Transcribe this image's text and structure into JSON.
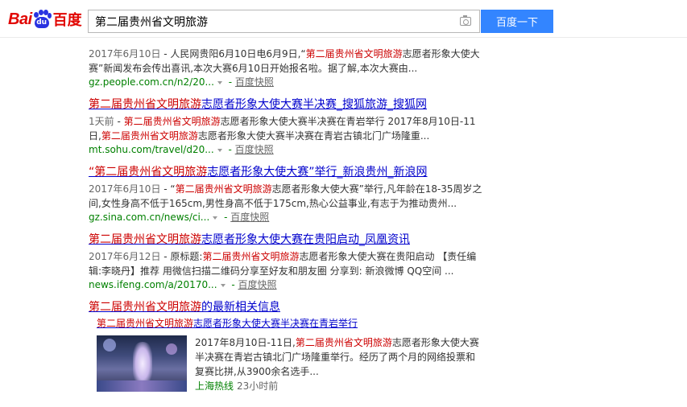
{
  "header": {
    "logo_left": "Bai",
    "logo_paw": "du",
    "logo_right": "百度",
    "search_value": "第二届贵州省文明旅游",
    "search_button": "百度一下"
  },
  "results": [
    {
      "abstract": {
        "date": "2017年6月10日",
        "sep": " - ",
        "pre": "人民网贵阳6月10日电6月9日,“",
        "hl": "第二届贵州省文明旅游",
        "post": "志愿者形象大使大赛”新闻发布会传出喜讯,本次大赛6月10日开始报名啦。据了解,本次大赛由..."
      },
      "url": "gz.people.com.cn/n2/20...",
      "kuaizhao": "百度快照"
    },
    {
      "title": {
        "hl": "第二届贵州省文明旅游",
        "rest": "志愿者形象大使大赛半决赛_搜狐旅游_搜狐网"
      },
      "abstract": {
        "date": "1天前",
        "sep": " - ",
        "hl1": "第二届贵州省文明旅游",
        "mid": "志愿者形象大使大赛半决赛在青岩举行 2017年8月10日-11日,",
        "hl2": "第二届贵州省文明旅游",
        "post": "志愿者形象大使大赛半决赛在青岩古镇北门广场隆重..."
      },
      "url": "mt.sohu.com/travel/d20...",
      "kuaizhao": "百度快照"
    },
    {
      "title": {
        "hl": "“第二届贵州省文明旅游",
        "rest": "志愿者形象大使大赛”举行_新浪贵州_新浪网"
      },
      "abstract": {
        "date": "2017年6月10日",
        "sep": " - ",
        "pre": "“",
        "hl": "第二届贵州省文明旅游",
        "post": "志愿者形象大使大赛”举行,凡年龄在18-35周岁之间,女性身高不低于165cm,男性身高不低于175cm,热心公益事业,有志于为推动贵州..."
      },
      "url": "gz.sina.com.cn/news/ci...",
      "kuaizhao": "百度快照"
    },
    {
      "title": {
        "hl": "第二届贵州省文明旅游",
        "rest": "志愿者形象大使大赛在贵阳启动_凤凰资讯"
      },
      "abstract": {
        "date": "2017年6月12日",
        "sep": " - ",
        "pre": "原标题:",
        "hl": "第二届贵州省文明旅游",
        "post": "志愿者形象大使大赛在贵阳启动 【责任编辑:李晓丹】推荐 用微信扫描二维码分享至好友和朋友圈 分享到: 新浪微博 QQ空间 ..."
      },
      "url": "news.ifeng.com/a/20170...",
      "kuaizhao": "百度快照"
    }
  ],
  "related": {
    "title_hl": "第二届贵州省文明旅游",
    "title_rest": "的最新相关信息",
    "sub_hl": "第二届贵州省文明旅游",
    "sub_rest": "志愿者形象大使大赛半决赛在青岩举行",
    "card": {
      "pre": "2017年8月10日-11日,",
      "hl": "第二届贵州省文明旅游",
      "post": "志愿者形象大使大赛半决赛在青岩古镇北门广场隆重举行。经历了两个月的网络投票和复赛比拼,从3900余名选手...",
      "source": "上海热线",
      "time": "23小时前"
    }
  }
}
